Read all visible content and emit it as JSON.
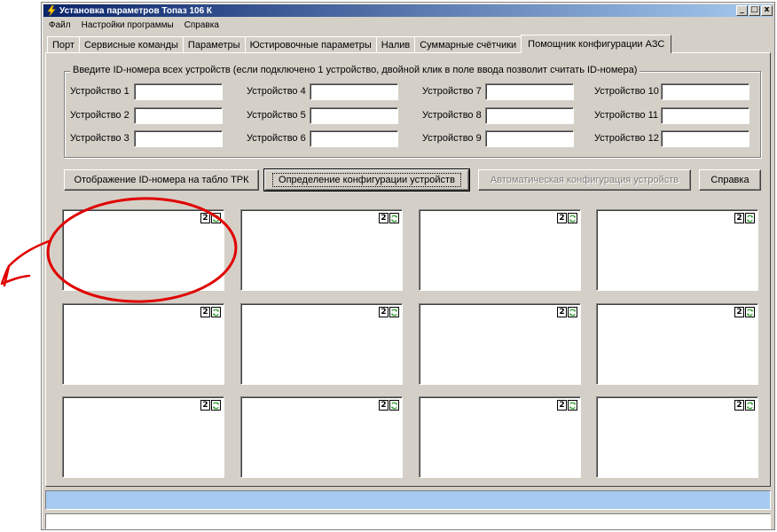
{
  "window": {
    "title": "Установка параметров Топаз 106 К",
    "controls": [
      "_",
      "□",
      "x"
    ]
  },
  "menu": [
    {
      "label": "Файл"
    },
    {
      "label": "Настройки программы"
    },
    {
      "label": "Справка"
    }
  ],
  "tabs": [
    {
      "label": "Порт"
    },
    {
      "label": "Сервисные команды"
    },
    {
      "label": "Параметры"
    },
    {
      "label": "Юстировочные параметры"
    },
    {
      "label": "Налив"
    },
    {
      "label": "Суммарные счётчики"
    },
    {
      "label": "Помощник конфигурации АЗС",
      "active": true
    }
  ],
  "id_group": {
    "legend": "Введите ID-номера всех устройств (если подключено 1 устройство, двойной клик в поле ввода позволит считать ID-номера)",
    "devices": [
      {
        "label": "Устройство 1",
        "value": ""
      },
      {
        "label": "Устройство 2",
        "value": ""
      },
      {
        "label": "Устройство 3",
        "value": ""
      },
      {
        "label": "Устройство 4",
        "value": ""
      },
      {
        "label": "Устройство 5",
        "value": ""
      },
      {
        "label": "Устройство 6",
        "value": ""
      },
      {
        "label": "Устройство 7",
        "value": ""
      },
      {
        "label": "Устройство 8",
        "value": ""
      },
      {
        "label": "Устройство 9",
        "value": ""
      },
      {
        "label": "Устройство 10",
        "value": ""
      },
      {
        "label": "Устройство 11",
        "value": ""
      },
      {
        "label": "Устройство 12",
        "value": ""
      }
    ]
  },
  "buttons": {
    "show_id": "Отображение ID-номера на табло ТРК",
    "detect_config": "Определение конфигурации устройств",
    "auto_config": "Автоматическая конфигурация устройств",
    "help": "Справка"
  },
  "device_boxes": [
    {
      "badge": "2"
    },
    {
      "badge": "2"
    },
    {
      "badge": "2"
    },
    {
      "badge": "2"
    },
    {
      "badge": "2"
    },
    {
      "badge": "2"
    },
    {
      "badge": "2"
    },
    {
      "badge": "2"
    },
    {
      "badge": "2"
    },
    {
      "badge": "2"
    },
    {
      "badge": "2"
    },
    {
      "badge": "2"
    }
  ],
  "colors": {
    "titlebar_start": "#0a246a",
    "titlebar_end": "#a6caf0",
    "face": "#d4d0c8",
    "status_blue": "#a6caf0",
    "annotation_red": "#e00000",
    "refresh_green": "#2e9e2e"
  },
  "icons": {
    "app": "lightning-bolt-icon",
    "refresh": "refresh-arrows-icon"
  }
}
